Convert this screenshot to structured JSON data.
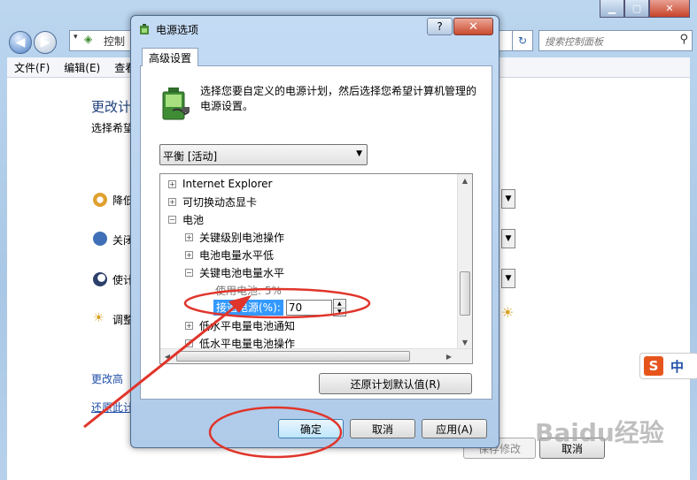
{
  "bg_window": {
    "address_text": "控制",
    "search_placeholder": "搜索控制面板",
    "menu": [
      "文件(F)",
      "编辑(E)",
      "查看"
    ],
    "heading": "更改计",
    "subheading": "选择希望",
    "rows": [
      "降低",
      "关闭",
      "使计",
      "调整"
    ],
    "links": [
      "更改高",
      "还原此计"
    ],
    "save_label": "保存修改",
    "cancel_label": "取消"
  },
  "dialog": {
    "title": "电源选项",
    "help_label": "?",
    "close_label": "✕",
    "tab_label": "高级设置",
    "description": "选择您要自定义的电源计划，然后选择您希望计算机管理的电源设置。",
    "plan_selected": "平衡 [活动]",
    "tree": [
      {
        "label": "Internet Explorer",
        "level": 0,
        "expander": "+"
      },
      {
        "label": "可切换动态显卡",
        "level": 0,
        "expander": "+"
      },
      {
        "label": "电池",
        "level": 0,
        "expander": "−"
      },
      {
        "label": "关键级别电池操作",
        "level": 1,
        "expander": "+"
      },
      {
        "label": "电池电量水平低",
        "level": 1,
        "expander": "+"
      },
      {
        "label": "关键电池电量水平",
        "level": 1,
        "expander": "−"
      }
    ],
    "on_battery_label": "使用电池: 5%",
    "plugged_in_label": "接通电源(%):",
    "plugged_in_value": "70",
    "tree_after": [
      {
        "label": "低水平电量电池通知",
        "level": 1,
        "expander": "+"
      },
      {
        "label": "低水平电量电池操作",
        "level": 1,
        "expander": "+"
      }
    ],
    "restore_label": "还原计划默认值(R)",
    "ok_label": "确定",
    "cancel_label": "取消",
    "apply_label": "应用(A)"
  },
  "ime": {
    "logo": "S",
    "mode": "中"
  },
  "watermark": "Baidu经验",
  "colors": {
    "annotation_red": "#e0352b",
    "selection_blue": "#3399ff"
  }
}
